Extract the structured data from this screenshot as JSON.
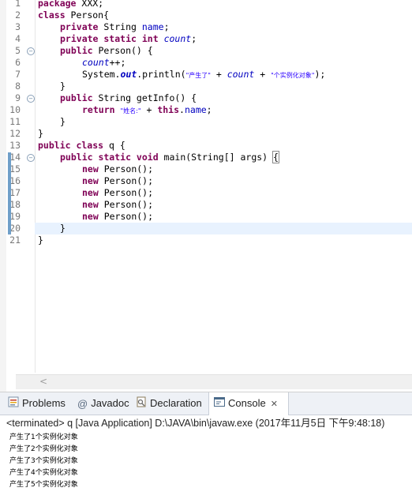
{
  "editor": {
    "line_numbers": [
      "1",
      "2",
      "3",
      "4",
      "5",
      "6",
      "7",
      "8",
      "9",
      "10",
      "11",
      "12",
      "13",
      "14",
      "15",
      "16",
      "17",
      "18",
      "19",
      "20",
      "21"
    ],
    "fold_markers": [
      "−",
      "−",
      "−"
    ],
    "code": {
      "l1_kw": "package",
      "l1_rest": " XXX;",
      "l2_kw": "class",
      "l2_rest": " Person{",
      "l3_kw": "private",
      "l3_type": " String ",
      "l3_field": "name",
      "l3_end": ";",
      "l4_kw": "private static int",
      "l4_sp": " ",
      "l4_field": "count",
      "l4_end": ";",
      "l5_kw": "public",
      "l5_rest": " Person() {",
      "l6_field": "count",
      "l6_rest": "++;",
      "l7_a": "System.",
      "l7_out": "out",
      "l7_b": ".println(",
      "l7_s1": "\"产生了\"",
      "l7_c": " + ",
      "l7_count": "count",
      "l7_d": " + ",
      "l7_s2": "\"个实例化对象\"",
      "l7_e": ");",
      "l8": "}",
      "l9_kw": "public",
      "l9_rest": " String getInfo() {",
      "l10_kw": "return",
      "l10_sp": " ",
      "l10_s": "\"姓名:\"",
      "l10_plus": " + ",
      "l10_this": "this",
      "l10_dot": ".",
      "l10_field": "name",
      "l10_end": ";",
      "l11": "}",
      "l12": "}",
      "l13_kw": "public class",
      "l13_rest": " q {",
      "l14_kw": "public static void",
      "l14_rest": " main(String[] args) ",
      "l14_brace": "{",
      "new_kw": "new",
      "new_rest": " Person();",
      "l20": "}",
      "l21": "}"
    },
    "hscroll_arrow": "<"
  },
  "tabs": [
    {
      "label": "Problems",
      "icon": "problems-icon"
    },
    {
      "label": "Javadoc",
      "icon": "javadoc-icon",
      "glyph": "@"
    },
    {
      "label": "Declaration",
      "icon": "declaration-icon"
    },
    {
      "label": "Console",
      "icon": "console-icon"
    }
  ],
  "tab_close": "✕",
  "console": {
    "header": "<terminated> q [Java Application] D:\\JAVA\\bin\\javaw.exe (2017年11月5日 下午9:48:18)",
    "lines": [
      "产生了1个实例化对象",
      "产生了2个实例化对象",
      "产生了3个实例化对象",
      "产生了4个实例化对象",
      "产生了5个实例化对象"
    ]
  },
  "colors": {
    "keyword": "#7f0055",
    "field": "#0000c0",
    "string": "#2a00ff",
    "current_line": "#e8f2fe"
  }
}
